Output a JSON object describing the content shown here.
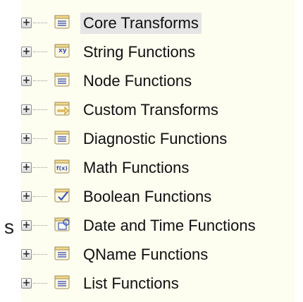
{
  "stray_text": "s",
  "tree": {
    "items": [
      {
        "label": "Core Transforms",
        "icon": "list-doc-icon",
        "selected": true
      },
      {
        "label": "String Functions",
        "icon": "xy-string-icon",
        "selected": false
      },
      {
        "label": "Node Functions",
        "icon": "list-doc-icon",
        "selected": false
      },
      {
        "label": "Custom Transforms",
        "icon": "transform-arrow-icon",
        "selected": false
      },
      {
        "label": "Diagnostic Functions",
        "icon": "list-doc-icon",
        "selected": false
      },
      {
        "label": "Math Functions",
        "icon": "fx-icon",
        "selected": false
      },
      {
        "label": "Boolean Functions",
        "icon": "checkmark-icon",
        "selected": false
      },
      {
        "label": "Date and Time Functions",
        "icon": "calendar-icon",
        "selected": false
      },
      {
        "label": "QName Functions",
        "icon": "list-doc-icon",
        "selected": false
      },
      {
        "label": "List Functions",
        "icon": "list-doc-icon",
        "selected": false
      }
    ],
    "expander_symbol": "+",
    "icon_overlays": {
      "xy": "xy",
      "fx": "f(x)"
    }
  },
  "colors": {
    "panel_bg": "#fdfdf0",
    "selection_bg": "#e5e5e5",
    "icon_blue": "#3a55b8",
    "folder_yellow": "#f3d98a"
  }
}
